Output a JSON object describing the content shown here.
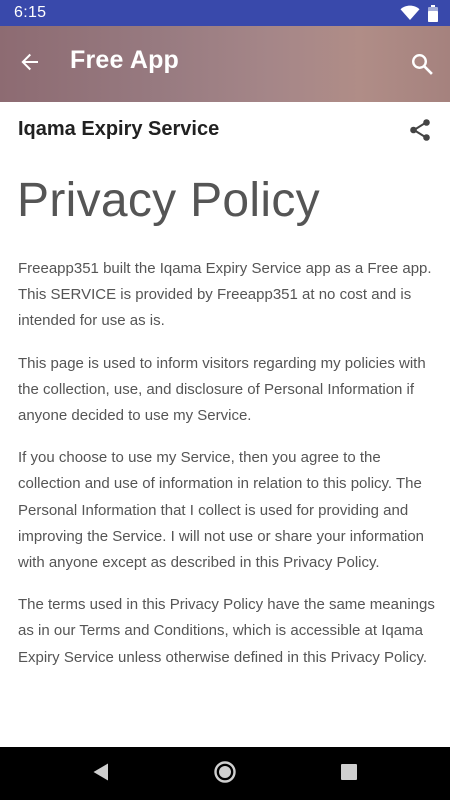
{
  "status_bar": {
    "time": "6:15",
    "icons": [
      "wifi-icon",
      "battery-icon"
    ]
  },
  "app_bar": {
    "title": "Free App",
    "back_icon": "arrow-left-icon",
    "search_icon": "search-icon"
  },
  "content": {
    "app_name": "Iqama Expiry Service",
    "share_icon": "share-icon",
    "policy_title": "Privacy Policy",
    "paragraphs": [
      "Freeapp351 built the Iqama Expiry Service app as a Free app. This SERVICE is provided by Freeapp351 at no cost and is intended for use as is.",
      "This page is used to inform visitors regarding my policies with the collection, use, and disclosure of Personal Information if anyone decided to use my Service.",
      "If you choose to use my Service, then you agree to the collection and use of information in relation to this policy. The Personal Information that I collect is used for providing and improving the Service. I will not use or share your information with anyone except as described in this Privacy Policy.",
      "The terms used in this Privacy Policy have the same meanings as in our Terms and Conditions, which is accessible at Iqama Expiry Service unless otherwise defined in this Privacy Policy."
    ]
  },
  "nav_bar": {
    "icons": [
      "nav-back-icon",
      "nav-home-icon",
      "nav-recent-icon"
    ]
  },
  "colors": {
    "status_bar": "#3949ab",
    "app_bar_start": "#8d6b72",
    "app_bar_end": "#a5827e",
    "text_primary": "#212121",
    "text_secondary": "#555555",
    "nav_bar": "#000000"
  }
}
